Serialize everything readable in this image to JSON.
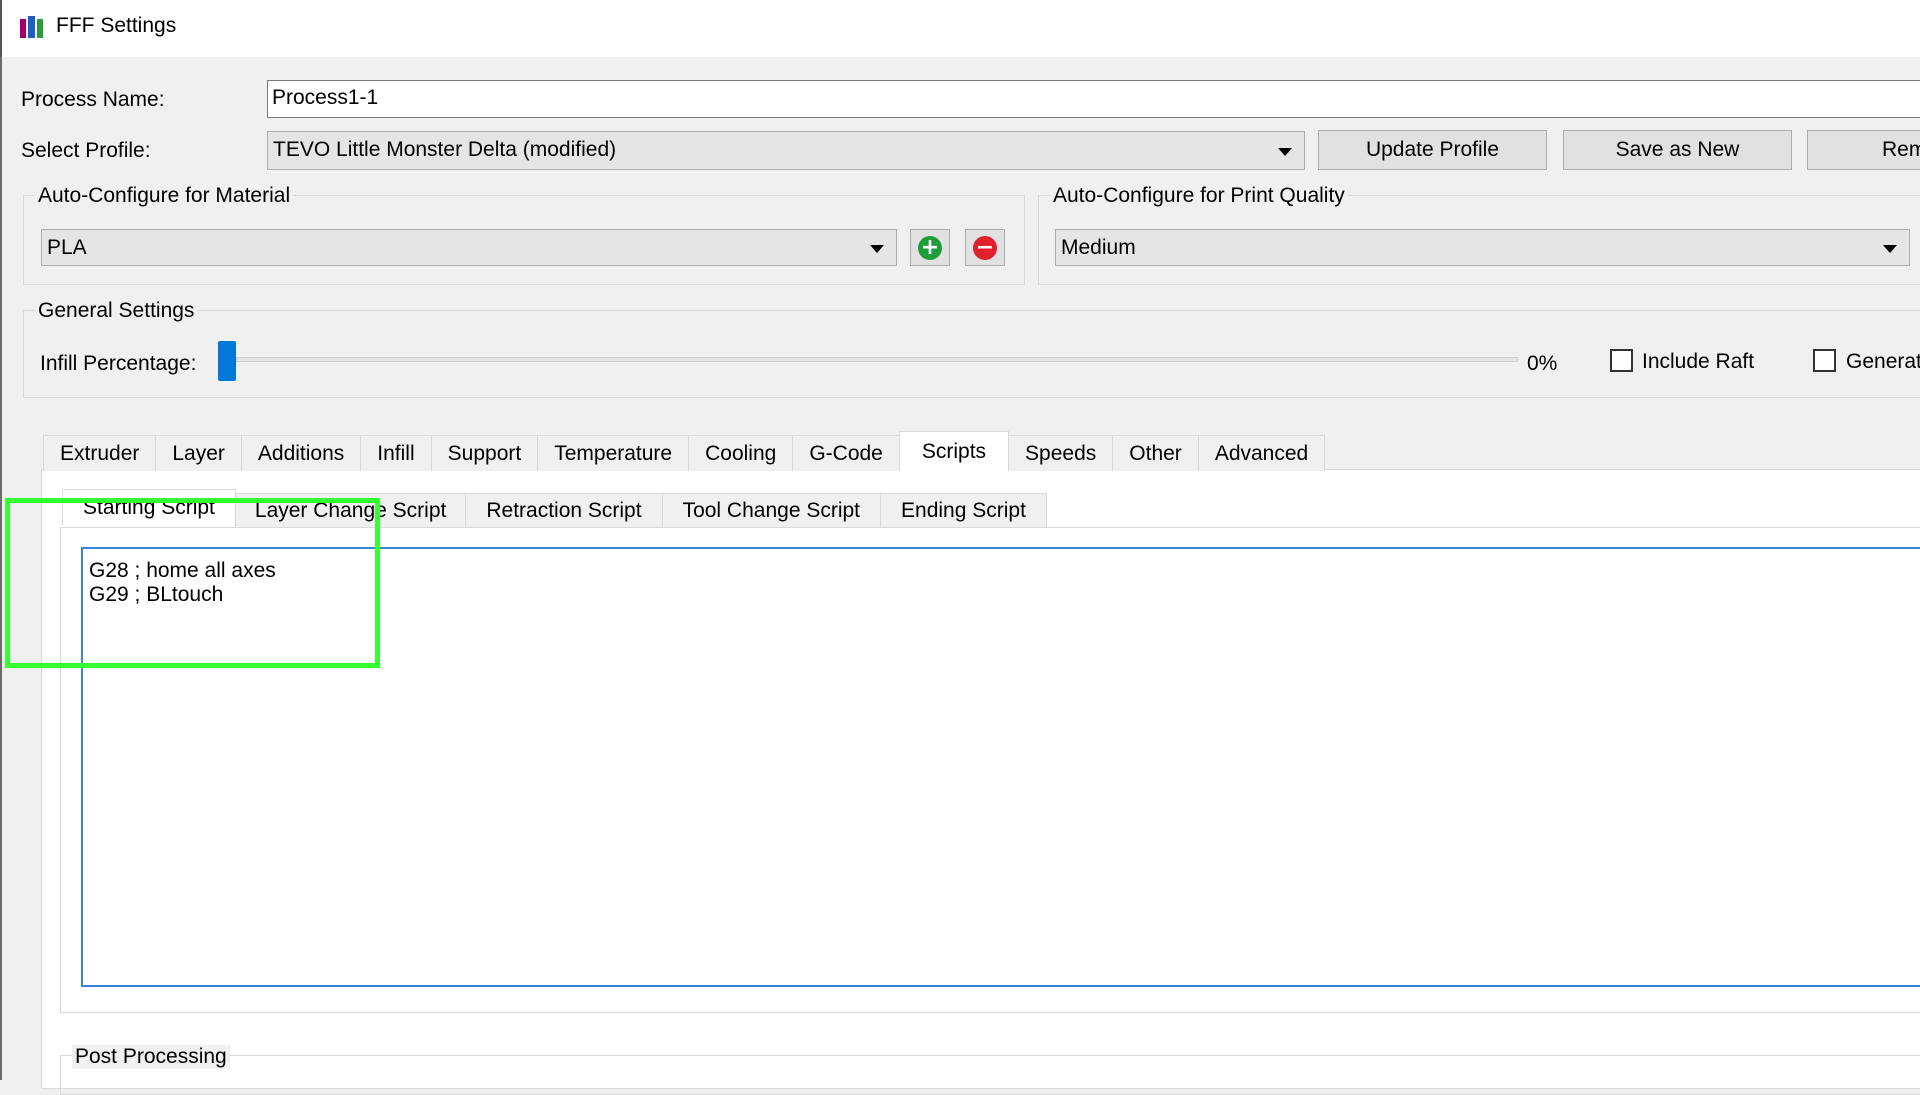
{
  "window": {
    "title": "FFF Settings",
    "app_icon": "app-logo-icon"
  },
  "process": {
    "label": "Process Name:",
    "value": "Process1-1"
  },
  "profile": {
    "label": "Select Profile:",
    "selected": "TEVO Little Monster Delta (modified)",
    "update_label": "Update Profile",
    "save_label": "Save as New",
    "remove_label": "Rem"
  },
  "material": {
    "group_title": "Auto-Configure for Material",
    "selected": "PLA",
    "add_icon": "add-icon",
    "remove_icon": "remove-icon"
  },
  "quality": {
    "group_title": "Auto-Configure for Print Quality",
    "selected": "Medium"
  },
  "general": {
    "group_title": "General Settings",
    "infill_label": "Infill Percentage:",
    "infill_value": "0%",
    "infill_fraction": 0,
    "raft_label": "Include Raft",
    "raft_checked": false,
    "generate_label": "Generat",
    "generate_checked": false
  },
  "tabs": [
    {
      "label": "Extruder",
      "active": false
    },
    {
      "label": "Layer",
      "active": false
    },
    {
      "label": "Additions",
      "active": false
    },
    {
      "label": "Infill",
      "active": false
    },
    {
      "label": "Support",
      "active": false
    },
    {
      "label": "Temperature",
      "active": false
    },
    {
      "label": "Cooling",
      "active": false
    },
    {
      "label": "G-Code",
      "active": false
    },
    {
      "label": "Scripts",
      "active": true
    },
    {
      "label": "Speeds",
      "active": false
    },
    {
      "label": "Other",
      "active": false
    },
    {
      "label": "Advanced",
      "active": false
    }
  ],
  "script_tabs": [
    {
      "label": "Starting Script",
      "active": true
    },
    {
      "label": "Layer Change Script",
      "active": false
    },
    {
      "label": "Retraction Script",
      "active": false
    },
    {
      "label": "Tool Change Script",
      "active": false
    },
    {
      "label": "Ending Script",
      "active": false
    }
  ],
  "script": {
    "lines": [
      "G28 ; home all axes",
      "G29 ; BLtouch"
    ]
  },
  "post_processing": {
    "group_title": "Post Processing"
  },
  "colors": {
    "highlight": "#33ff33",
    "accent": "#0078d7",
    "add": "#1e9e3a",
    "remove": "#e0202a"
  }
}
